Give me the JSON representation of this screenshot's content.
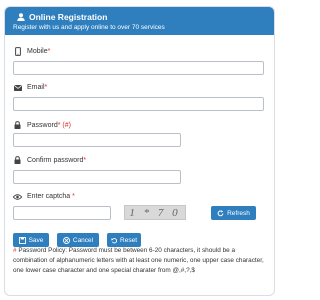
{
  "header": {
    "title": "Online Registration",
    "subtitle": "Register with us and apply online to over 70 services"
  },
  "form": {
    "mobile_label": "Mobile",
    "email_label": "Email",
    "password_label": "Password",
    "password_hint": "(#)",
    "confirm_label": "Confirm password",
    "captcha_label": "Enter captcha",
    "required_mark": "*",
    "captcha_text": "1 * 7 0"
  },
  "buttons": {
    "refresh": "Refresh",
    "save": "Save",
    "cancel": "Cancel",
    "reset": "Reset"
  },
  "policy": {
    "mark": "#",
    "text": "Password Policy: Password must be between 6-20 characters, it should be a combination of alphanumeric letters with at least one numeric, one upper case character, one lower case character and one special charater from @,#,?,$"
  },
  "colors": {
    "accent": "#2f7fbf",
    "required": "#d9302c"
  },
  "icons": {
    "header": "user-icon",
    "mobile": "mobile-phone-icon",
    "email": "envelope-icon",
    "password": "lock-icon",
    "confirm": "lock-icon",
    "captcha": "eye-icon",
    "refresh": "refresh-icon",
    "save": "save-icon",
    "cancel": "cancel-circle-icon",
    "reset": "undo-icon"
  }
}
